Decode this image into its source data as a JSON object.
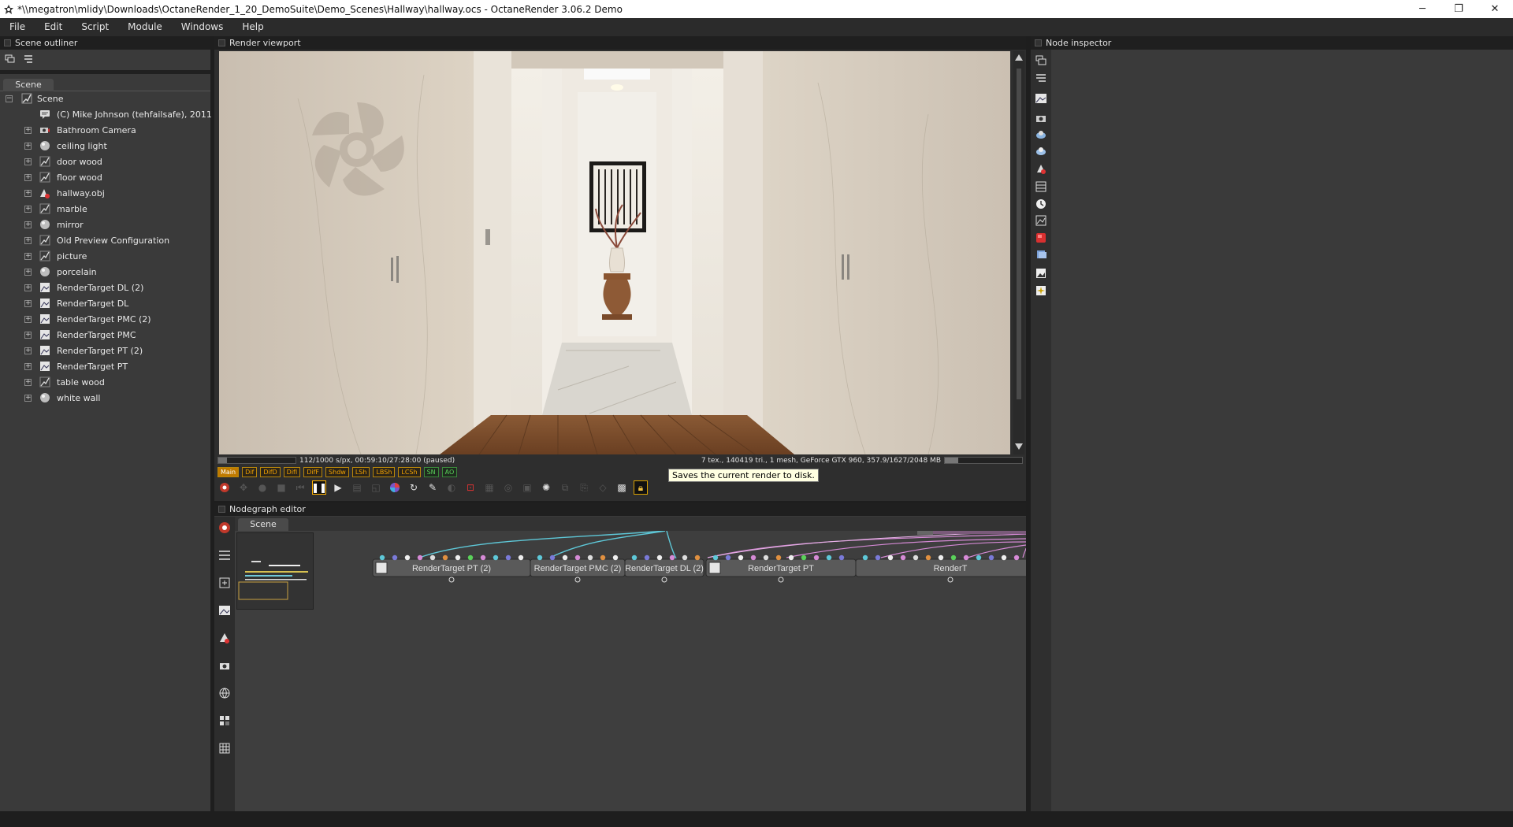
{
  "window": {
    "title": "*\\\\megatron\\mlidy\\Downloads\\OctaneRender_1_20_DemoSuite\\Demo_Scenes\\Hallway\\hallway.ocs - OctaneRender 3.06.2 Demo",
    "minimize": "─",
    "restore": "❐",
    "close": "✕"
  },
  "menu": [
    "File",
    "Edit",
    "Script",
    "Module",
    "Windows",
    "Help"
  ],
  "outliner": {
    "header": "Scene outliner",
    "tab": "Scene",
    "root": "Scene",
    "items": [
      {
        "label": "(C) Mike Johnson (tehfailsafe), 2011",
        "icon": "comment-icon",
        "expandable": false
      },
      {
        "label": "Bathroom Camera",
        "icon": "camera-icon",
        "expandable": true
      },
      {
        "label": "ceiling light",
        "icon": "material-sphere-icon",
        "expandable": true
      },
      {
        "label": "door wood",
        "icon": "texture-icon",
        "expandable": true
      },
      {
        "label": "floor wood",
        "icon": "texture-icon",
        "expandable": true
      },
      {
        "label": "hallway.obj",
        "icon": "mesh-icon",
        "expandable": true
      },
      {
        "label": "marble",
        "icon": "texture-icon",
        "expandable": true
      },
      {
        "label": "mirror",
        "icon": "material-sphere-icon",
        "expandable": true
      },
      {
        "label": "Old Preview Configuration",
        "icon": "texture-icon",
        "expandable": true
      },
      {
        "label": "picture",
        "icon": "texture-icon",
        "expandable": true
      },
      {
        "label": "porcelain",
        "icon": "material-sphere-icon",
        "expandable": true
      },
      {
        "label": "RenderTarget DL (2)",
        "icon": "render-target-icon",
        "expandable": true
      },
      {
        "label": "RenderTarget DL",
        "icon": "render-target-icon",
        "expandable": true
      },
      {
        "label": "RenderTarget PMC (2)",
        "icon": "render-target-icon",
        "expandable": true
      },
      {
        "label": "RenderTarget PMC",
        "icon": "render-target-icon",
        "expandable": true
      },
      {
        "label": "RenderTarget PT (2)",
        "icon": "render-target-icon",
        "expandable": true
      },
      {
        "label": "RenderTarget PT",
        "icon": "render-target-icon",
        "expandable": true
      },
      {
        "label": "table wood",
        "icon": "texture-icon",
        "expandable": true
      },
      {
        "label": "white wall",
        "icon": "material-sphere-icon",
        "expandable": true
      }
    ]
  },
  "viewport": {
    "header": "Render viewport",
    "status_left": "112/1000 s/px, 00:59:10/27:28:00 (paused)",
    "status_right": "7 tex., 140419 tri., 1 mesh, GeForce GTX 960, 357.9/1627/2048 MB",
    "progress_fraction": 0.112,
    "gpu_mem_fraction": 0.17,
    "passes": [
      "Main",
      "Dif",
      "DifD",
      "DifI",
      "DifF",
      "Shdw",
      "LSh",
      "LBSh",
      "LCSh",
      "SN",
      "AO"
    ],
    "tooltip": "Saves the current render to disk."
  },
  "nodegraph": {
    "header": "Nodegraph editor",
    "tab": "Scene",
    "nodes": [
      "RenderTarget PT (2)",
      "RenderTarget PMC (2)",
      "RenderTarget DL (2)",
      "RenderTarget PT",
      "RenderT"
    ]
  },
  "inspector": {
    "header": "Node inspector"
  },
  "colors": {
    "accent_orange": "#ffb200",
    "pin_cyan": "#5ec8d8",
    "pin_pink": "#d68ad6",
    "pin_orange": "#e09040",
    "pin_green": "#5ad15a"
  }
}
